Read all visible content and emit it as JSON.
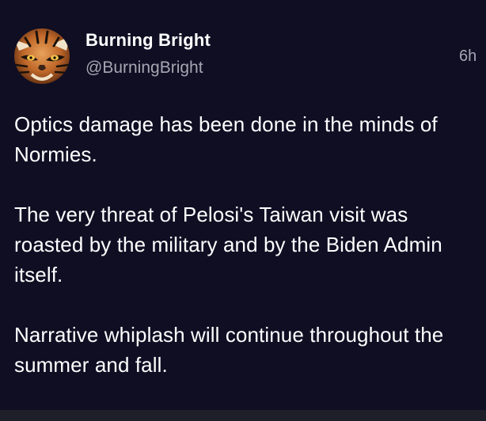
{
  "post": {
    "author": {
      "display_name": "Burning Bright",
      "handle": "@BurningBright",
      "avatar_icon": "tiger-avatar"
    },
    "timestamp": "6h",
    "paragraphs": [
      "Optics damage has been done in the minds of Normies.",
      "The very threat of Pelosi's Taiwan visit was roasted by the military and by the Biden Admin itself.",
      "Narrative whiplash will continue throughout the summer and fall."
    ]
  },
  "colors": {
    "background": "#100e23",
    "text_primary": "#ffffff",
    "text_secondary": "#a4a7b2"
  }
}
